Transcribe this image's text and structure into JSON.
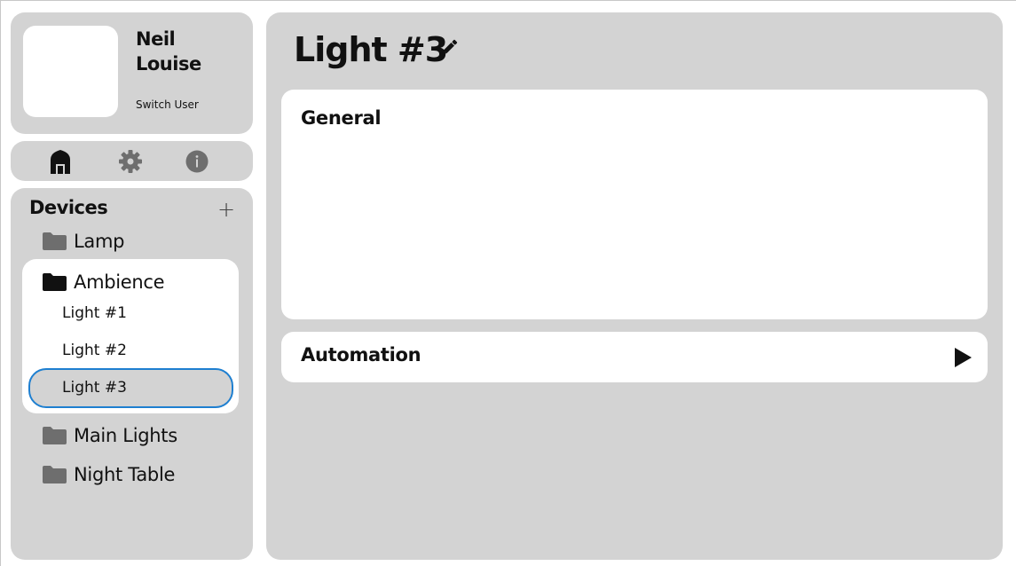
{
  "user": {
    "first_name": "Neil",
    "last_name": "Louise",
    "switch_label": "Switch User"
  },
  "nav": {
    "items": [
      {
        "icon": "home-icon",
        "active": true
      },
      {
        "icon": "gear-icon",
        "active": false
      },
      {
        "icon": "info-icon",
        "active": false
      }
    ]
  },
  "devices": {
    "title": "Devices",
    "add_label": "+",
    "folders": [
      {
        "label": "Lamp",
        "expanded": false
      },
      {
        "label": "Ambience",
        "expanded": true,
        "children": [
          "Light #1",
          "Light #2",
          "Light #3"
        ],
        "selected_child": "Light #3"
      },
      {
        "label": "Main Lights",
        "expanded": false
      },
      {
        "label": "Night Table",
        "expanded": false
      }
    ]
  },
  "main": {
    "title": "Light #3",
    "sections": [
      {
        "title": "General"
      },
      {
        "title": "Automation"
      }
    ]
  },
  "colors": {
    "panel": "#d3d3d3",
    "selection_border": "#1e7fd0",
    "folder_collapsed": "#6e6e6e",
    "folder_expanded": "#111111",
    "nav_icon": "#6e6e6e",
    "nav_icon_active": "#111111"
  }
}
